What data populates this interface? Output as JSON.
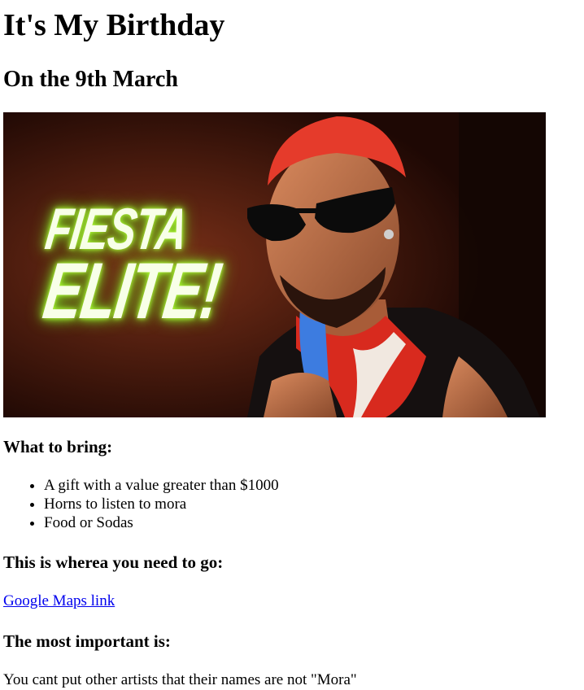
{
  "heading": "It's My Birthday",
  "subheading": "On the 9th March",
  "hero": {
    "line1": "FIESTA",
    "line2": "ELITE!",
    "glow_color": "#b6ff3a"
  },
  "bring": {
    "title": "What to bring:",
    "items": [
      "A gift with a value greater than $1000",
      "Horns to listen to mora",
      "Food or Sodas"
    ]
  },
  "location": {
    "title": "This is wherea you need to go:",
    "link_text": "Google Maps link",
    "link_color": "#0000ee"
  },
  "important": {
    "title": "The most important is:",
    "text": "You cant put other artists that their names are not \"Mora\""
  }
}
